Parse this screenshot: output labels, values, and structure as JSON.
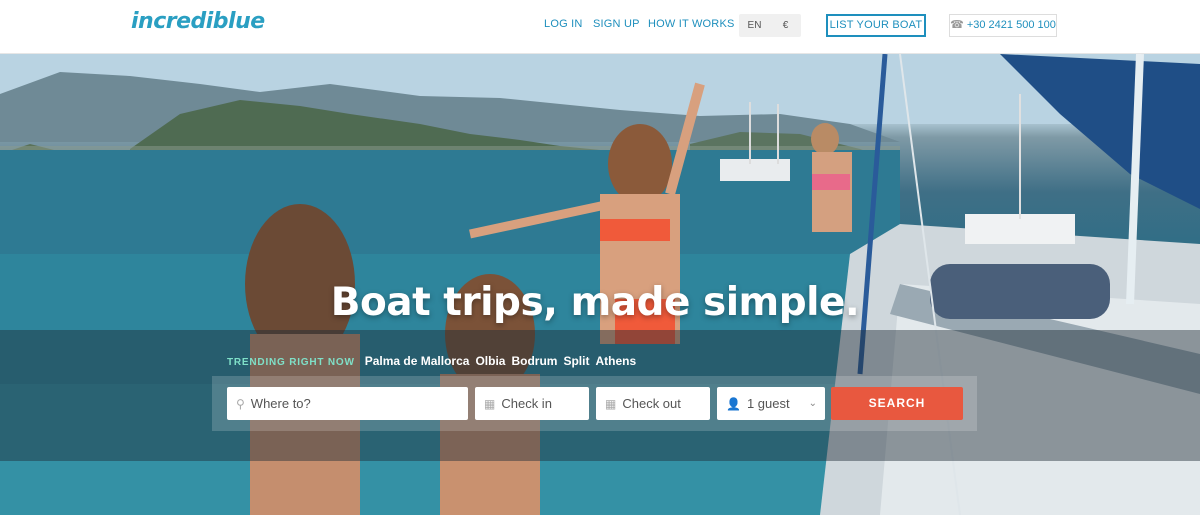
{
  "header": {
    "logo": "incrediblue",
    "nav": [
      "LOG IN",
      "SIGN UP",
      "HOW IT WORKS"
    ],
    "lang": "EN",
    "currency": "€",
    "list_boat": "LIST YOUR BOAT",
    "phone_icon": "phone-icon",
    "phone": "+30 2421 500 100"
  },
  "hero": {
    "title": "Boat trips, made simple.",
    "trending_label": "TRENDING RIGHT NOW",
    "trending": [
      "Palma de Mallorca",
      "Olbia",
      "Bodrum",
      "Split",
      "Athens"
    ]
  },
  "search": {
    "where_placeholder": "Where to?",
    "checkin_placeholder": "Check in",
    "checkout_placeholder": "Check out",
    "guests_value": "1 guest",
    "search_label": "SEARCH"
  },
  "colors": {
    "brand": "#2a9fc2",
    "search_button": "#e8583f",
    "trending_label": "#7fe0c8"
  }
}
